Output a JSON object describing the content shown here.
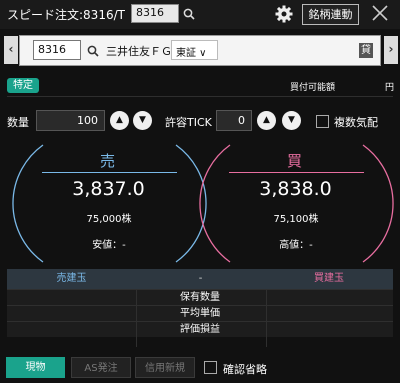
{
  "header": {
    "title": "スピード注文:8316/T",
    "code": "8316",
    "link_button": "銘柄連動"
  },
  "stock": {
    "code": "8316",
    "name": "三井住友ＦＧ",
    "market": "東証 ∨",
    "lend_badge": "貸"
  },
  "account": {
    "type_badge": "特定",
    "buying_power_label": "買付可能額",
    "buying_power_value": "",
    "currency": "円"
  },
  "order": {
    "qty_label": "数量",
    "qty_value": "100",
    "tick_label": "許容TICK",
    "tick_value": "0",
    "multi_label": "複数気配"
  },
  "sell": {
    "label": "売",
    "price": "3,837.0",
    "volume": "75,000株",
    "low": "安値：-",
    "color": "#7ab9e8"
  },
  "buy": {
    "label": "買",
    "price": "3,838.0",
    "volume": "75,100株",
    "high": "高値：-",
    "color": "#e86ea0"
  },
  "positions": {
    "sell_header": "売建玉",
    "mid_header": "-",
    "buy_header": "買建玉",
    "rows": [
      "保有数量",
      "平均単価",
      "評価損益"
    ]
  },
  "bottom": {
    "genbutsu": "現物",
    "as_order": "AS発注",
    "credit_new": "信用新規",
    "skip_confirm": "確認省略"
  }
}
